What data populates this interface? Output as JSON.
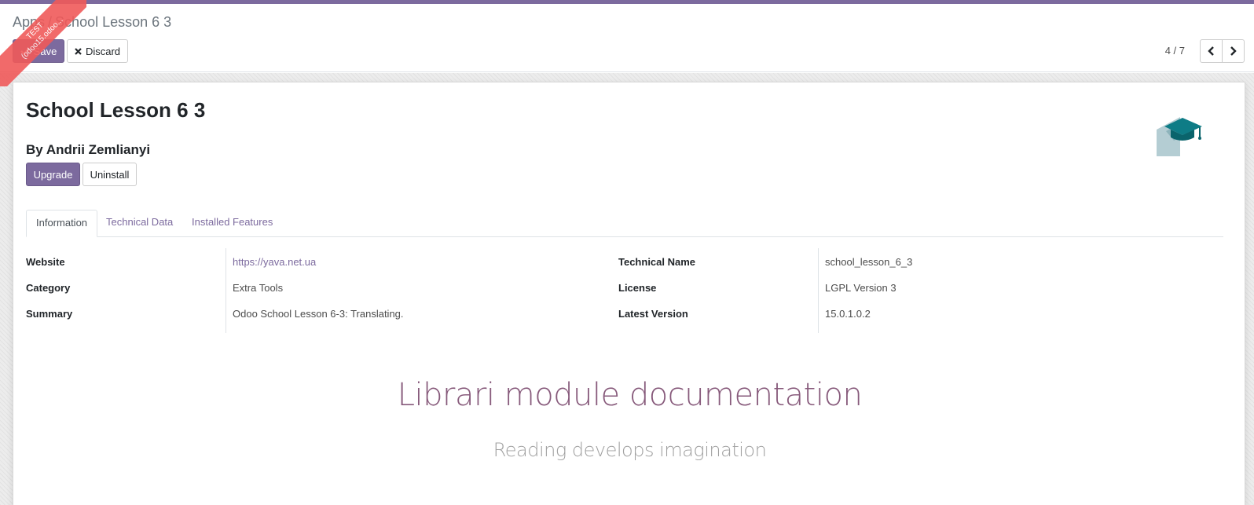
{
  "breadcrumb": {
    "root": "Apps",
    "separator": "/",
    "current": "School Lesson 6 3"
  },
  "toolbar": {
    "save_label": "Save",
    "discard_label": "Discard"
  },
  "pager": {
    "value": "4 / 7"
  },
  "ribbon": {
    "line1": "TEST",
    "line2": "(odoo15.odoo..."
  },
  "module": {
    "title": "School Lesson 6 3",
    "author": "By Andrii Zemlianyi",
    "upgrade_label": "Upgrade",
    "uninstall_label": "Uninstall",
    "icon": "graduation-cap-icon"
  },
  "tabs": [
    {
      "label": "Information",
      "active": true
    },
    {
      "label": "Technical Data",
      "active": false
    },
    {
      "label": "Installed Features",
      "active": false
    }
  ],
  "info_left": [
    {
      "label": "Website",
      "value": "https://yava.net.ua"
    },
    {
      "label": "Category",
      "value": "Extra Tools"
    },
    {
      "label": "Summary",
      "value": "Odoo School Lesson 6-3: Translating."
    }
  ],
  "info_right": [
    {
      "label": "Technical Name",
      "value": "school_lesson_6_3"
    },
    {
      "label": "License",
      "value": "LGPL Version 3"
    },
    {
      "label": "Latest Version",
      "value": "15.0.1.0.2"
    }
  ],
  "description": {
    "title": "Librari module documentation",
    "subtitle": "Reading develops imagination"
  },
  "colors": {
    "primary": "#7c6a9e",
    "doc_title": "#875a7b",
    "ribbon": "#f05a5a",
    "icon_teal": "#0e7c86"
  }
}
